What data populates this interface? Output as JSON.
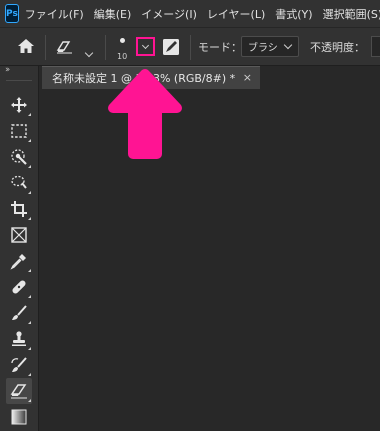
{
  "app": {
    "logo_text": "Ps"
  },
  "menubar": {
    "items": [
      "ファイル(F)",
      "編集(E)",
      "イメージ(I)",
      "レイヤー(L)",
      "書式(Y)",
      "選択範囲(S)"
    ]
  },
  "optionsbar": {
    "brush_size": "10",
    "mode_label": "モード：",
    "mode_value": "ブラシ",
    "opacity_label": "不透明度："
  },
  "document": {
    "tab_title": "名称未設定 1 @ 33.3% (RGB/8#) *",
    "close_glyph": "×"
  },
  "toolbox": {
    "collapse_glyph": "››"
  },
  "annotation": {
    "color": "#ff1493"
  },
  "colors": {
    "menubar_bg": "#323232",
    "canvas_bg": "#282828",
    "accent": "#ff1493"
  }
}
